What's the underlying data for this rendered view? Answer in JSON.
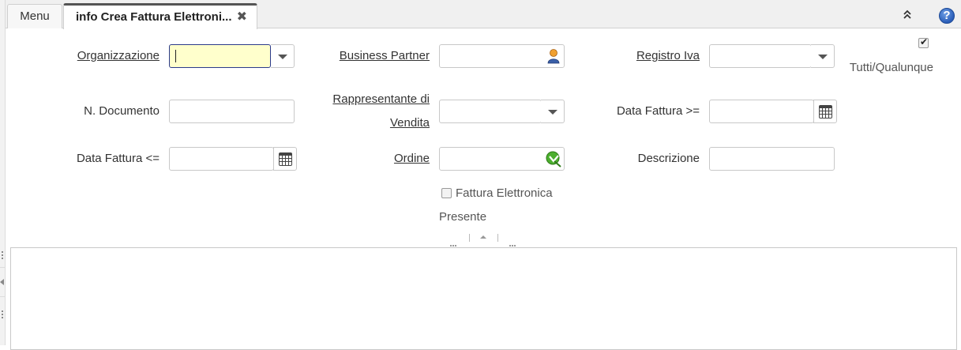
{
  "tabs": {
    "menu_label": "Menu",
    "active_label": "info Crea Fattura Elettroni...",
    "close_glyph": "✖"
  },
  "toolbar": {
    "collapse_icon": "double-chevron-up-icon",
    "help_glyph": "?"
  },
  "form": {
    "organizzazione": {
      "label": "Organizzazione",
      "value": ""
    },
    "business_partner": {
      "label": "Business Partner",
      "value": ""
    },
    "registro_iva": {
      "label": "Registro Iva",
      "value": ""
    },
    "tutti_qualunque": {
      "label": "Tutti/Qualunque",
      "checked": true
    },
    "n_documento": {
      "label": "N. Documento",
      "value": ""
    },
    "rappresentante": {
      "label_line1": "Rappresentante di",
      "label_line2": "Vendita",
      "value": ""
    },
    "data_fattura_from": {
      "label": "Data Fattura >=",
      "value": ""
    },
    "data_fattura_to": {
      "label": "Data Fattura <=",
      "value": ""
    },
    "ordine": {
      "label": "Ordine",
      "value": ""
    },
    "descrizione": {
      "label": "Descrizione",
      "value": ""
    },
    "fattura_elettronica": {
      "label": "Fattura Elettronica",
      "checked": false
    },
    "presente": {
      "label": "Presente"
    }
  },
  "colors": {
    "focus_bg": "#ffffcc",
    "focus_border": "#2b3a8a",
    "help_blue": "#2a5db8"
  }
}
